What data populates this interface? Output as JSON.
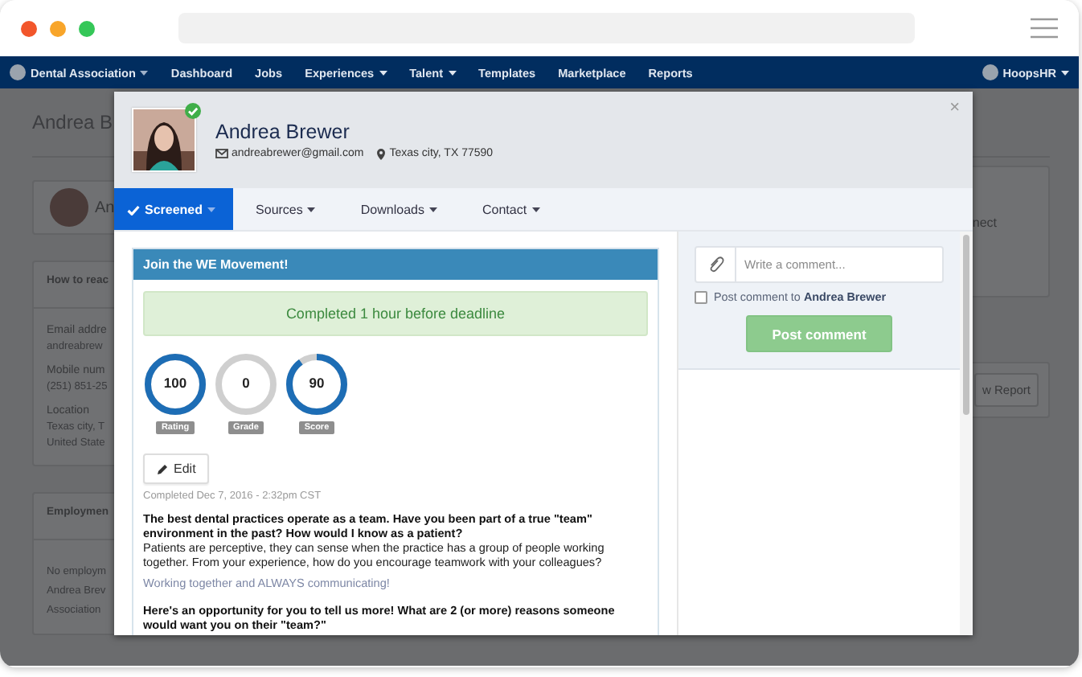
{
  "nav": {
    "brand": "Dental Association",
    "items": [
      {
        "label": "Dashboard",
        "dropdown": false
      },
      {
        "label": "Jobs",
        "dropdown": false
      },
      {
        "label": "Experiences",
        "dropdown": true
      },
      {
        "label": "Talent",
        "dropdown": true
      },
      {
        "label": "Templates",
        "dropdown": false
      },
      {
        "label": "Marketplace",
        "dropdown": false
      },
      {
        "label": "Reports",
        "dropdown": false
      }
    ],
    "user": "HoopsHR"
  },
  "background_page": {
    "title": "Andrea B",
    "profile_name": "An",
    "contact_card": {
      "heading": "How to reac",
      "fields": [
        {
          "label": "Email addre",
          "lines": [
            "andreabrew"
          ]
        },
        {
          "label": "Mobile num",
          "lines": [
            "(251) 851-25"
          ]
        },
        {
          "label": "Location",
          "lines": [
            "Texas city, T",
            "United State"
          ]
        }
      ]
    },
    "employment_card": {
      "heading": "Employmen",
      "lines": [
        "No employm",
        "Andrea Brev",
        "Association"
      ]
    },
    "side_text": "nect",
    "report_button": "w Report"
  },
  "modal": {
    "candidate": {
      "name": "Andrea Brewer",
      "email": "andreabrewer@gmail.com",
      "location": "Texas city, TX 77590",
      "verified": true
    },
    "close": "×",
    "tabs": [
      {
        "label": "Screened",
        "selected": true
      },
      {
        "label": "Sources",
        "selected": false
      },
      {
        "label": "Downloads",
        "selected": false
      },
      {
        "label": "Contact",
        "selected": false
      }
    ],
    "assessment": {
      "title": "Join the WE Movement!",
      "alert": "Completed 1 hour before deadline",
      "scores": [
        {
          "value": "100",
          "label": "Rating",
          "level": 1
        },
        {
          "value": "0",
          "label": "Grade",
          "level": 0
        },
        {
          "value": "90",
          "label": "Score",
          "level": 0.9
        }
      ],
      "edit": "Edit",
      "completed": "Completed Dec 7, 2016 - 2:32pm CST",
      "answers": [
        {
          "question": "The best dental practices operate as a team. Have you been part of a true \"team\" environment in the past? How would I know as a patient?",
          "prompt": "Patients are perceptive, they can sense when the practice has a group of people working together. From your experience, how do you encourage teamwork with your colleagues?",
          "response": "Working together and ALWAYS communicating!"
        },
        {
          "question": "Here's an opportunity for you to tell us more! What are 2 (or more) reasons someone would want you on their \"team?\""
        }
      ]
    },
    "comment": {
      "placeholder": "Write a comment...",
      "notify_label": "Post comment to **Andrea Brewer**",
      "notify_checked": false,
      "button": "Post comment"
    }
  }
}
